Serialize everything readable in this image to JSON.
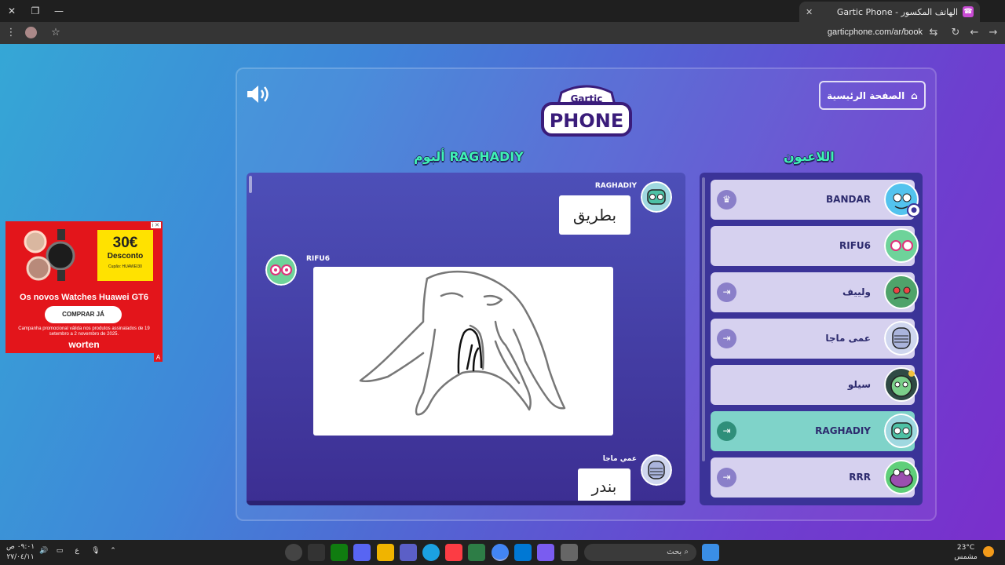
{
  "browser": {
    "tab_title": "الهاتف المكسور - Gartic Phone",
    "url": "garticphone.com/ar/book",
    "new_tab": "+",
    "close_tab": "✕",
    "win_close": "✕",
    "win_restore": "❐",
    "win_min": "—"
  },
  "header": {
    "home_label": "الصفحة الرئيسية",
    "logo_top": "Gartic",
    "logo_main": "PHONE"
  },
  "album": {
    "title": "ألبوم RAGHADIY",
    "entries": [
      {
        "author": "RAGHADIY",
        "text": "بطريق"
      },
      {
        "author": "RIFU6",
        "text": ""
      },
      {
        "author": "عمي ماجا",
        "text": "بندر"
      }
    ]
  },
  "players": {
    "title": "اللاعبون",
    "list": [
      {
        "name": "BANDAR",
        "icon": "crown-icon"
      },
      {
        "name": "RIFU6",
        "icon": ""
      },
      {
        "name": "ولييف",
        "icon": "exit-icon"
      },
      {
        "name": "عمى ماجا",
        "icon": "exit-icon"
      },
      {
        "name": "سيلو",
        "icon": ""
      },
      {
        "name": "RAGHADIY",
        "icon": "exit-icon"
      },
      {
        "name": "RRR",
        "icon": "exit-icon"
      }
    ]
  },
  "ad": {
    "price": "30€",
    "discount": "Desconto",
    "coupon": "Cupão: HUAWEI30",
    "headline": "Os novos Watches Huawei GT6",
    "cta": "COMPRAR JÁ",
    "fine_print": "Campanha promocional válida nos produtos assinalados de 19 setembro a 2 novembro de 2025.",
    "brand": "worten",
    "choice": "i ✕",
    "badge": "A"
  },
  "taskbar": {
    "search_placeholder": "بحث",
    "weather_temp": "23°C",
    "weather_desc": "مشمس",
    "clock_time": "٠٩:٠١ ص",
    "clock_date": "٢٧/٠٤/١١",
    "lang": "ع"
  },
  "colors": {
    "accent_green": "#3ff2b4",
    "panel_dark": "#3b3398",
    "player_row": "#d6d1ef",
    "player_active": "#7fd3c9"
  }
}
